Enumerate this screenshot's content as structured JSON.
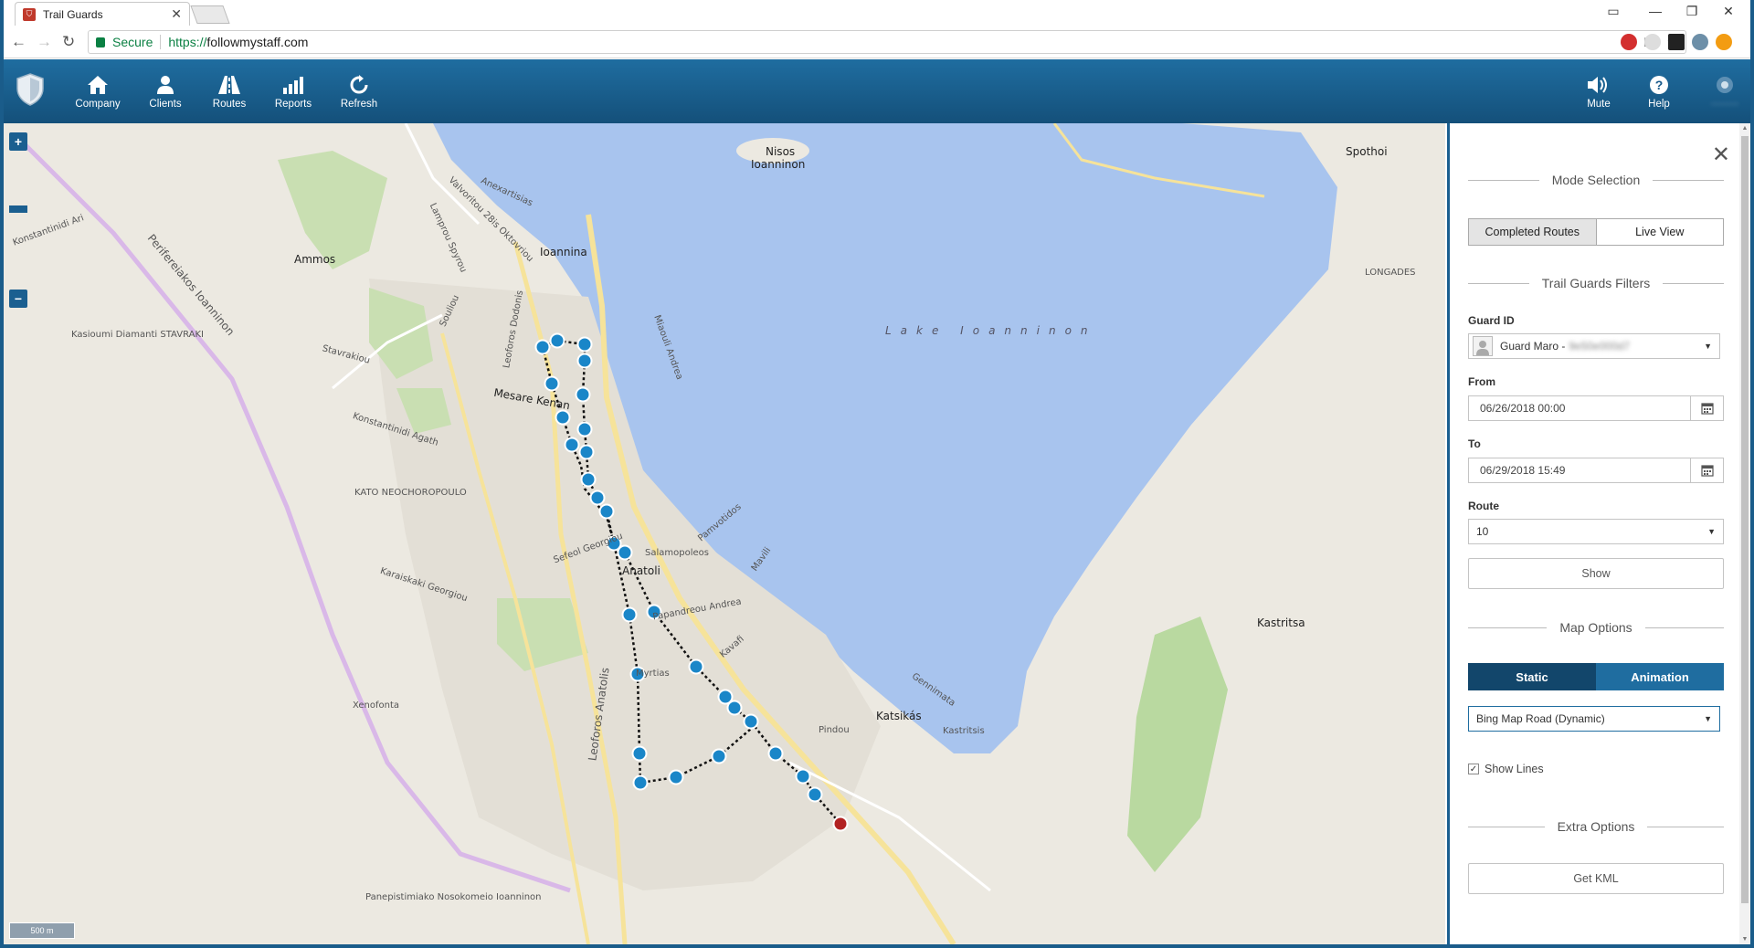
{
  "browser": {
    "tab_title": "Trail Guards",
    "secure_label": "Secure",
    "url_proto": "https://",
    "url_host": "followmystaff.com"
  },
  "nav": {
    "items": [
      {
        "label": "Company",
        "icon": "home-icon"
      },
      {
        "label": "Clients",
        "icon": "user-icon"
      },
      {
        "label": "Routes",
        "icon": "road-icon"
      },
      {
        "label": "Reports",
        "icon": "bar-chart-icon"
      },
      {
        "label": "Refresh",
        "icon": "refresh-icon"
      }
    ],
    "right": [
      {
        "label": "Mute",
        "icon": "speaker-icon"
      },
      {
        "label": "Help",
        "icon": "help-icon"
      }
    ]
  },
  "map": {
    "zoom_in": "+",
    "zoom_out": "−",
    "scale": "500 m",
    "lake_label": "Lake Ioanninon",
    "labels": [
      {
        "text": "Ammos",
        "kind": "town"
      },
      {
        "text": "Ioannina",
        "kind": "town"
      },
      {
        "text": "Nisos",
        "kind": "town"
      },
      {
        "text": "Ioanninon",
        "kind": "town"
      },
      {
        "text": "Spothoi",
        "kind": "town"
      },
      {
        "text": "LONGADES",
        "kind": "town"
      },
      {
        "text": "Anatoli",
        "kind": "town"
      },
      {
        "text": "Katsikás",
        "kind": "town"
      },
      {
        "text": "Kastritsa",
        "kind": "town"
      },
      {
        "text": "Kastritsis",
        "kind": "road"
      },
      {
        "text": "Myrtias",
        "kind": "road"
      },
      {
        "text": "Anexartisias",
        "kind": "road"
      },
      {
        "text": "Valvoritou 28is Oktovriou",
        "kind": "road"
      },
      {
        "text": "Lamprou Spyrou",
        "kind": "road"
      },
      {
        "text": "Souliou",
        "kind": "road"
      },
      {
        "text": "Leoforos Dodonis",
        "kind": "road"
      },
      {
        "text": "Mesare Kenan",
        "kind": "road"
      },
      {
        "text": "Stavrakiou",
        "kind": "road"
      },
      {
        "text": "Konstantinidi Agath",
        "kind": "road"
      },
      {
        "text": "KATO NEOCHOROPOULO",
        "kind": "road"
      },
      {
        "text": "Kasioumi Diamanti STAVRAKI",
        "kind": "road"
      },
      {
        "text": "Konstantinidi Ari",
        "kind": "road"
      },
      {
        "text": "Perifereiakos Ioanninon",
        "kind": "road"
      },
      {
        "text": "Leoforos Anatolis",
        "kind": "road"
      },
      {
        "text": "Panepistimiako Nosokomeio Ioanninon",
        "kind": "road"
      },
      {
        "text": "Gennimata",
        "kind": "road"
      },
      {
        "text": "Pamvotidos",
        "kind": "road"
      },
      {
        "text": "Mavili",
        "kind": "road"
      },
      {
        "text": "Kavafi",
        "kind": "road"
      },
      {
        "text": "Papandreou Andrea",
        "kind": "road"
      },
      {
        "text": "Salamopoleos",
        "kind": "road"
      },
      {
        "text": "Sefeol Georgiou",
        "kind": "road"
      },
      {
        "text": "Karaiskaki Georgiou",
        "kind": "road"
      },
      {
        "text": "Xenofonta",
        "kind": "road"
      },
      {
        "text": "Pindou",
        "kind": "road"
      },
      {
        "text": "Miaouli Andrea",
        "kind": "road"
      }
    ]
  },
  "panel": {
    "close_label": "✕",
    "mode_title": "Mode Selection",
    "mode_options": [
      "Completed Routes",
      "Live View"
    ],
    "filters_title": "Trail Guards Filters",
    "guard_label": "Guard ID",
    "guard_value": "Guard Maro -",
    "guard_blurred": "9e50e000d7",
    "from_label": "From",
    "from_value": "06/26/2018 00:00",
    "to_label": "To",
    "to_value": "06/29/2018 15:49",
    "route_label": "Route",
    "route_value": "10",
    "show_button": "Show",
    "map_options_title": "Map Options",
    "map_modes": [
      "Static",
      "Animation"
    ],
    "map_type": "Bing Map Road (Dynamic)",
    "show_lines_label": "Show Lines",
    "show_lines_checked": "✓",
    "extra_title": "Extra Options",
    "kml_button": "Get KML"
  },
  "colors": {
    "accent": "#1f6da0",
    "accent_dark": "#12466b",
    "route_point": "#1a86c8",
    "route_end": "#b22222",
    "lake": "#a8c4ee"
  }
}
